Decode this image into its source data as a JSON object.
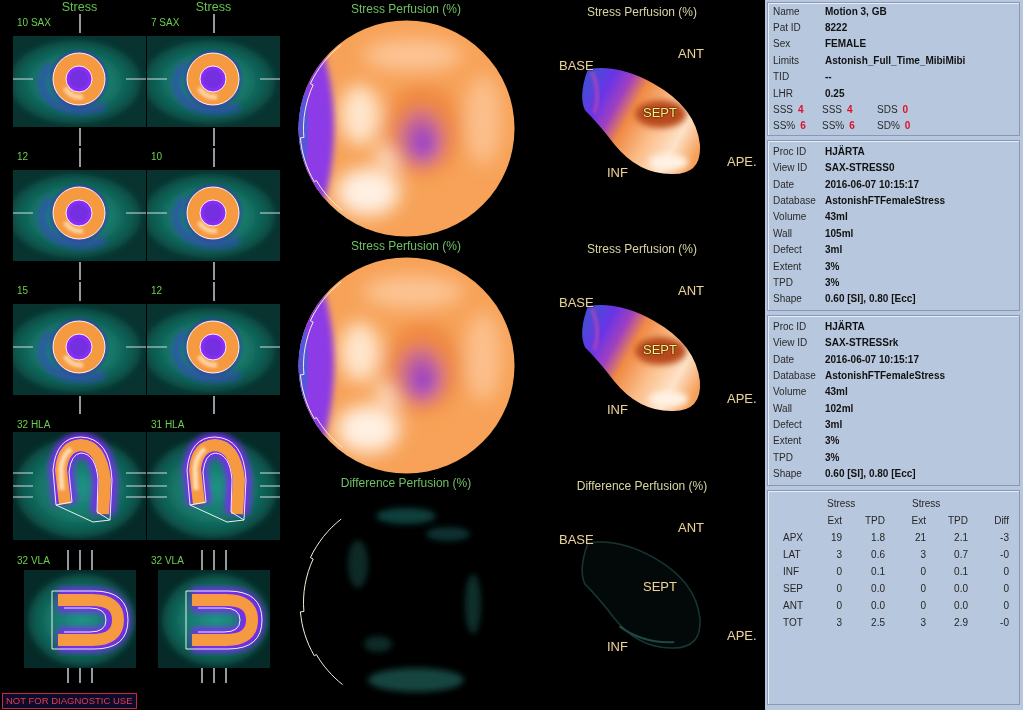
{
  "slice_headers": [
    {
      "title": "Stress"
    },
    {
      "title": "Stress"
    }
  ],
  "slice_rows": [
    [
      {
        "label": "10 SAX",
        "kind": "sax"
      },
      {
        "label": "7 SAX",
        "kind": "sax"
      }
    ],
    [
      {
        "label": "12",
        "kind": "sax"
      },
      {
        "label": "10",
        "kind": "sax"
      }
    ],
    [
      {
        "label": "15",
        "kind": "sax"
      },
      {
        "label": "12",
        "kind": "sax"
      }
    ],
    [
      {
        "label": "32 HLA",
        "kind": "hla"
      },
      {
        "label": "31 HLA",
        "kind": "hla"
      }
    ],
    [
      {
        "label": "32 VLA",
        "kind": "vla"
      },
      {
        "label": "32 VLA",
        "kind": "vla"
      }
    ]
  ],
  "warning": "NOT FOR DIAGNOSTIC USE",
  "polar_maps": [
    {
      "title": "Stress Perfusion (%)",
      "kind": "stress"
    },
    {
      "title": "Stress Perfusion (%)",
      "kind": "stress"
    },
    {
      "title": "Difference Perfusion (%)",
      "kind": "difference"
    }
  ],
  "views_3d": [
    {
      "title": "Stress Perfusion (%)",
      "kind": "stress",
      "labels": [
        {
          "kind": "base",
          "text": "BASE"
        },
        {
          "kind": "ant",
          "text": "ANT"
        },
        {
          "kind": "sept",
          "text": "SEPT"
        },
        {
          "kind": "ape",
          "text": "APE."
        },
        {
          "kind": "inf",
          "text": "INF"
        }
      ]
    },
    {
      "title": "Stress Perfusion (%)",
      "kind": "stress",
      "labels": [
        {
          "kind": "base",
          "text": "BASE"
        },
        {
          "kind": "ant",
          "text": "ANT"
        },
        {
          "kind": "sept",
          "text": "SEPT"
        },
        {
          "kind": "ape",
          "text": "APE."
        },
        {
          "kind": "inf",
          "text": "INF"
        }
      ]
    },
    {
      "title": "Difference Perfusion (%)",
      "kind": "difference",
      "labels": [
        {
          "kind": "base",
          "text": "BASE"
        },
        {
          "kind": "ant",
          "text": "ANT"
        },
        {
          "kind": "sept",
          "text": "SEPT"
        },
        {
          "kind": "ape",
          "text": "APE."
        },
        {
          "kind": "inf",
          "text": "INF"
        }
      ]
    }
  ],
  "patient": {
    "fields": [
      {
        "label": "Name",
        "value": "Motion 3, GB"
      },
      {
        "label": "Pat ID",
        "value": "8222"
      },
      {
        "label": "Sex",
        "value": "FEMALE"
      },
      {
        "label": "Limits",
        "value": "Astonish_Full_Time_MibiMibi"
      },
      {
        "label": "TID",
        "value": "--"
      },
      {
        "label": "LHR",
        "value": "0.25"
      }
    ],
    "scores": [
      [
        {
          "label": "SSS",
          "value": "4"
        },
        {
          "label": "SSS",
          "value": "4"
        },
        {
          "label": "SDS",
          "value": "0"
        }
      ],
      [
        {
          "label": "SS%",
          "value": "6"
        },
        {
          "label": "SS%",
          "value": "6"
        },
        {
          "label": "SD%",
          "value": "0"
        }
      ]
    ]
  },
  "studies": [
    {
      "fields": [
        {
          "label": "Proc ID",
          "value": "HJÄRTA"
        },
        {
          "label": "View ID",
          "value": "SAX-STRESS0"
        },
        {
          "label": "Date",
          "value": "2016-06-07 10:15:17"
        },
        {
          "label": "Database",
          "value": "AstonishFTFemaleStress"
        },
        {
          "label": "Volume",
          "value": "43ml"
        },
        {
          "label": "Wall",
          "value": "105ml"
        },
        {
          "label": "Defect",
          "value": "3ml"
        },
        {
          "label": "Extent",
          "value": "3%"
        },
        {
          "label": "TPD",
          "value": "3%"
        },
        {
          "label": "Shape",
          "value": "0.60 [SI], 0.80 [Ecc]"
        }
      ]
    },
    {
      "fields": [
        {
          "label": "Proc ID",
          "value": "HJÄRTA"
        },
        {
          "label": "View ID",
          "value": "SAX-STRESSrk"
        },
        {
          "label": "Date",
          "value": "2016-06-07 10:15:17"
        },
        {
          "label": "Database",
          "value": "AstonishFTFemaleStress"
        },
        {
          "label": "Volume",
          "value": "43ml"
        },
        {
          "label": "Wall",
          "value": "102ml"
        },
        {
          "label": "Defect",
          "value": "3ml"
        },
        {
          "label": "Extent",
          "value": "3%"
        },
        {
          "label": "TPD",
          "value": "3%"
        },
        {
          "label": "Shape",
          "value": "0.60 [SI], 0.80 [Ecc]"
        }
      ]
    }
  ],
  "segment_table": {
    "groups": [
      "Stress",
      "Stress"
    ],
    "columns": [
      "",
      "Ext",
      "TPD",
      "Ext",
      "TPD",
      "Diff"
    ],
    "rows": [
      [
        "APX",
        "19",
        "1.8",
        "21",
        "2.1",
        "-3"
      ],
      [
        "LAT",
        "3",
        "0.6",
        "3",
        "0.7",
        "-0"
      ],
      [
        "INF",
        "0",
        "0.1",
        "0",
        "0.1",
        "0"
      ],
      [
        "SEP",
        "0",
        "0.0",
        "0",
        "0.0",
        "0"
      ],
      [
        "ANT",
        "0",
        "0.0",
        "0",
        "0.0",
        "0"
      ],
      [
        "TOT",
        "3",
        "2.5",
        "3",
        "2.9",
        "-0"
      ]
    ]
  }
}
